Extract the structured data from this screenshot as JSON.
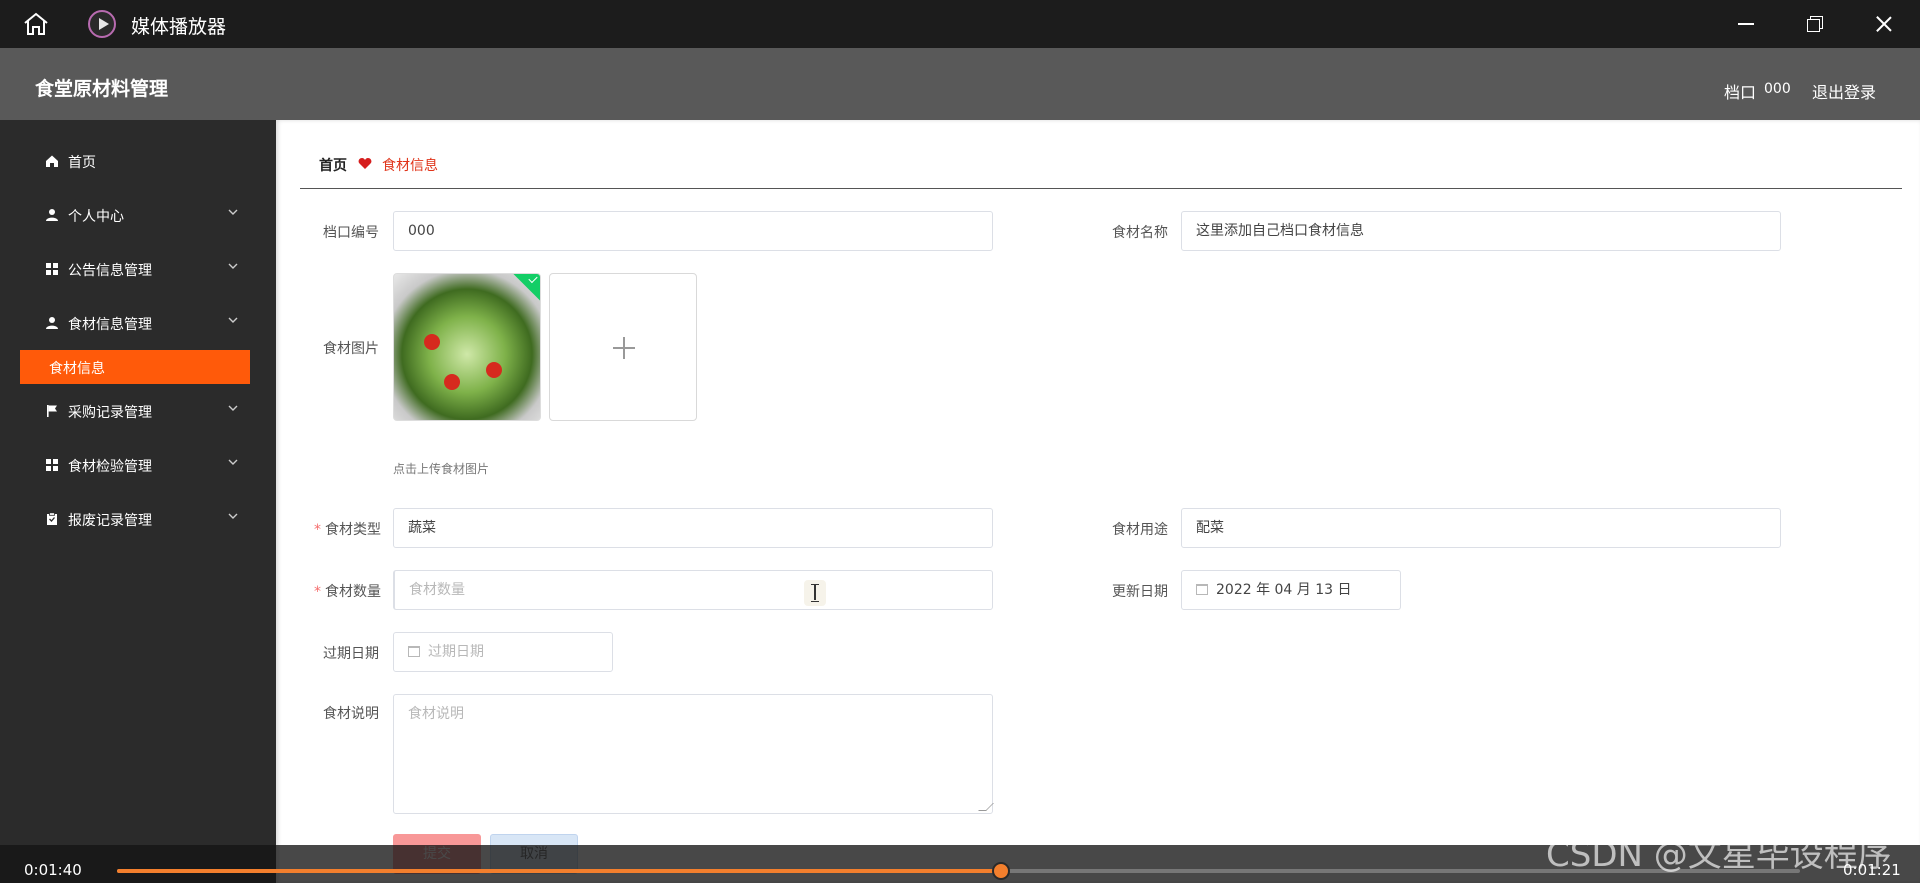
{
  "player": {
    "title": "媒体播放器",
    "time_current": "0:01:40",
    "time_total": "0:01:21",
    "progress": 0.525,
    "accent": "#f37f2d",
    "watermark": "CSDN @文星毕设程序"
  },
  "header": {
    "title": "食堂原材料管理",
    "stall_label": "档口",
    "stall_code": "000",
    "logout_label": "退出登录",
    "bg_color": "#595959"
  },
  "sidebar": {
    "items": [
      {
        "label": "首页",
        "icon": "home-icon"
      },
      {
        "label": "个人中心",
        "icon": "user-icon"
      },
      {
        "label": "公告信息管理",
        "icon": "grid-icon"
      },
      {
        "label": "食材信息管理",
        "icon": "user-icon"
      },
      {
        "label": "采购记录管理",
        "icon": "flag-icon"
      },
      {
        "label": "食材检验管理",
        "icon": "grid-icon"
      },
      {
        "label": "报废记录管理",
        "icon": "clipboard-icon"
      }
    ],
    "active_sub": "食材信息",
    "active_color": "#ff5a0a"
  },
  "breadcrumb": {
    "home": "首页",
    "current": "食材信息"
  },
  "form": {
    "stall_no": {
      "label": "档口编号",
      "value": "000"
    },
    "name": {
      "label": "食材名称",
      "value": "这里添加自己档口食材信息"
    },
    "image": {
      "label": "食材图片",
      "tip": "点击上传食材图片"
    },
    "type": {
      "label": "食材类型",
      "value": "蔬菜",
      "required_mark": "*"
    },
    "usage": {
      "label": "食材用途",
      "value": "配菜"
    },
    "quantity": {
      "label": "食材数量",
      "placeholder": "食材数量",
      "required_mark": "*"
    },
    "update_date": {
      "label": "更新日期",
      "value": "2022 年 04 月 13 日"
    },
    "expire_date": {
      "label": "过期日期",
      "placeholder": "过期日期"
    },
    "description": {
      "label": "食材说明",
      "placeholder": "食材说明"
    },
    "submit_label": "提交",
    "cancel_label": "取消"
  }
}
